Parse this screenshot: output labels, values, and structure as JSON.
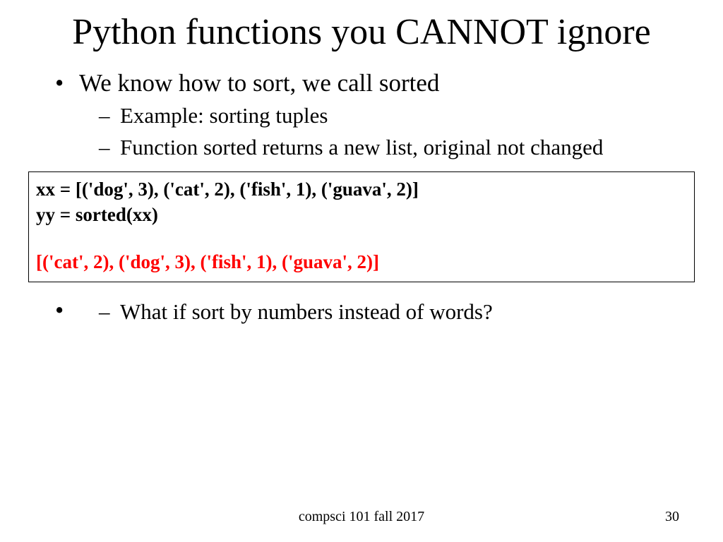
{
  "title": "Python functions you CANNOT ignore",
  "bullets": {
    "item1": "We know how to sort, we call sorted",
    "sub1": "Example: sorting tuples",
    "sub2": "Function sorted returns a new list, original not changed",
    "sub3": "What if sort by numbers instead of words?"
  },
  "code": {
    "line1": "xx = [('dog', 3), ('cat', 2), ('fish', 1),  ('guava', 2)]",
    "line2": "yy = sorted(xx)",
    "line3": "[('cat', 2), ('dog', 3), ('fish', 1), ('guava', 2)]"
  },
  "footer": {
    "course": "compsci 101 fall 2017",
    "page": "30"
  }
}
